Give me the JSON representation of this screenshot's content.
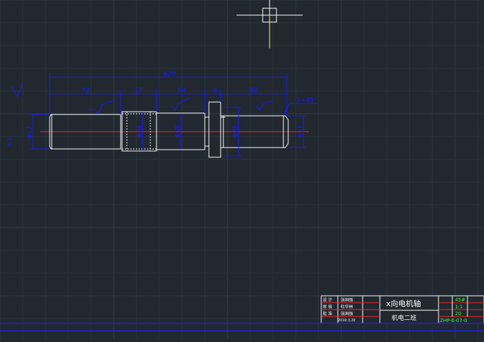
{
  "colors": {
    "background": "#212830",
    "grid": "#2b333d",
    "grid_major": "#323b46",
    "geometry": "#ffffff",
    "dimension": "#1a1aff",
    "centerline": "#ff2020",
    "crosshair_x": "#ffffff",
    "crosshair_y": "#ffff33",
    "title_green": "#33ff33"
  },
  "dimensions": {
    "overall_length": "620",
    "seg1_length": "72",
    "seg2_length": "17",
    "seg3_length": "54",
    "collar_length": "6",
    "seg4_length": "92",
    "chamfer": "2×45°",
    "dia_left": "Φ17",
    "dia_2": "Φ24",
    "dia_3": "Φ19",
    "dia_4": "Φ25",
    "dia_right": "Φ17",
    "roughness_left": "6.3"
  },
  "title_block": {
    "part_name": "x向电机轴",
    "class_name": "机电二班",
    "left_labels": [
      "设 计",
      "审 核",
      "批 准"
    ],
    "left_values": [
      "张国强",
      "杜华林",
      "张国强"
    ],
    "date": "2010.3.20",
    "material": "45#",
    "scale": "1:1",
    "sheet": "20",
    "drawing_no": "ZHP-6-07-0"
  }
}
